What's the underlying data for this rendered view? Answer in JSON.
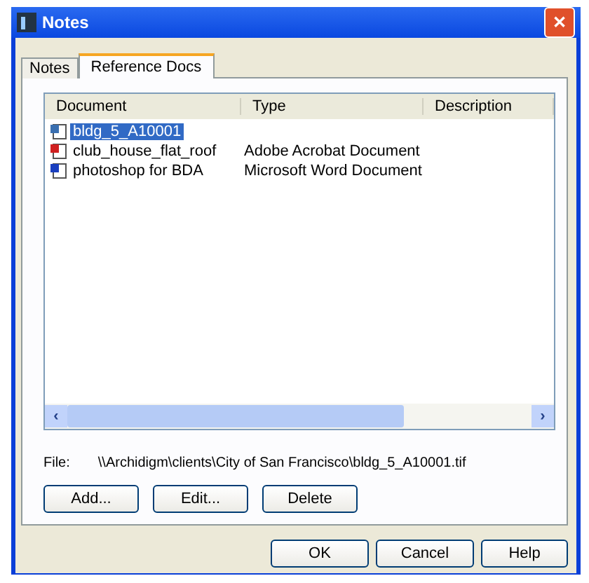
{
  "window": {
    "title": "Notes",
    "close": "✕"
  },
  "tabs": [
    {
      "label": "Notes",
      "selected": false
    },
    {
      "label": "Reference Docs",
      "selected": true
    }
  ],
  "table": {
    "columns": [
      "Document",
      "Type",
      "Description"
    ],
    "rows": [
      {
        "kind": "image",
        "document": "bldg_5_A10001",
        "type": "",
        "selected": true
      },
      {
        "kind": "pdf",
        "document": "club_house_flat_roof",
        "type": "Adobe Acrobat Document",
        "selected": false
      },
      {
        "kind": "word",
        "document": "photoshop for BDA",
        "type": "Microsoft Word Document",
        "selected": false
      }
    ],
    "scroll_left": "‹",
    "scroll_right": "›"
  },
  "file": {
    "label": "File:",
    "value": "\\\\Archidigm\\clients\\City of San Francisco\\bldg_5_A10001.tif"
  },
  "actions": [
    "Add...",
    "Edit...",
    "Delete"
  ],
  "buttons": [
    "OK",
    "Cancel",
    "Help"
  ]
}
